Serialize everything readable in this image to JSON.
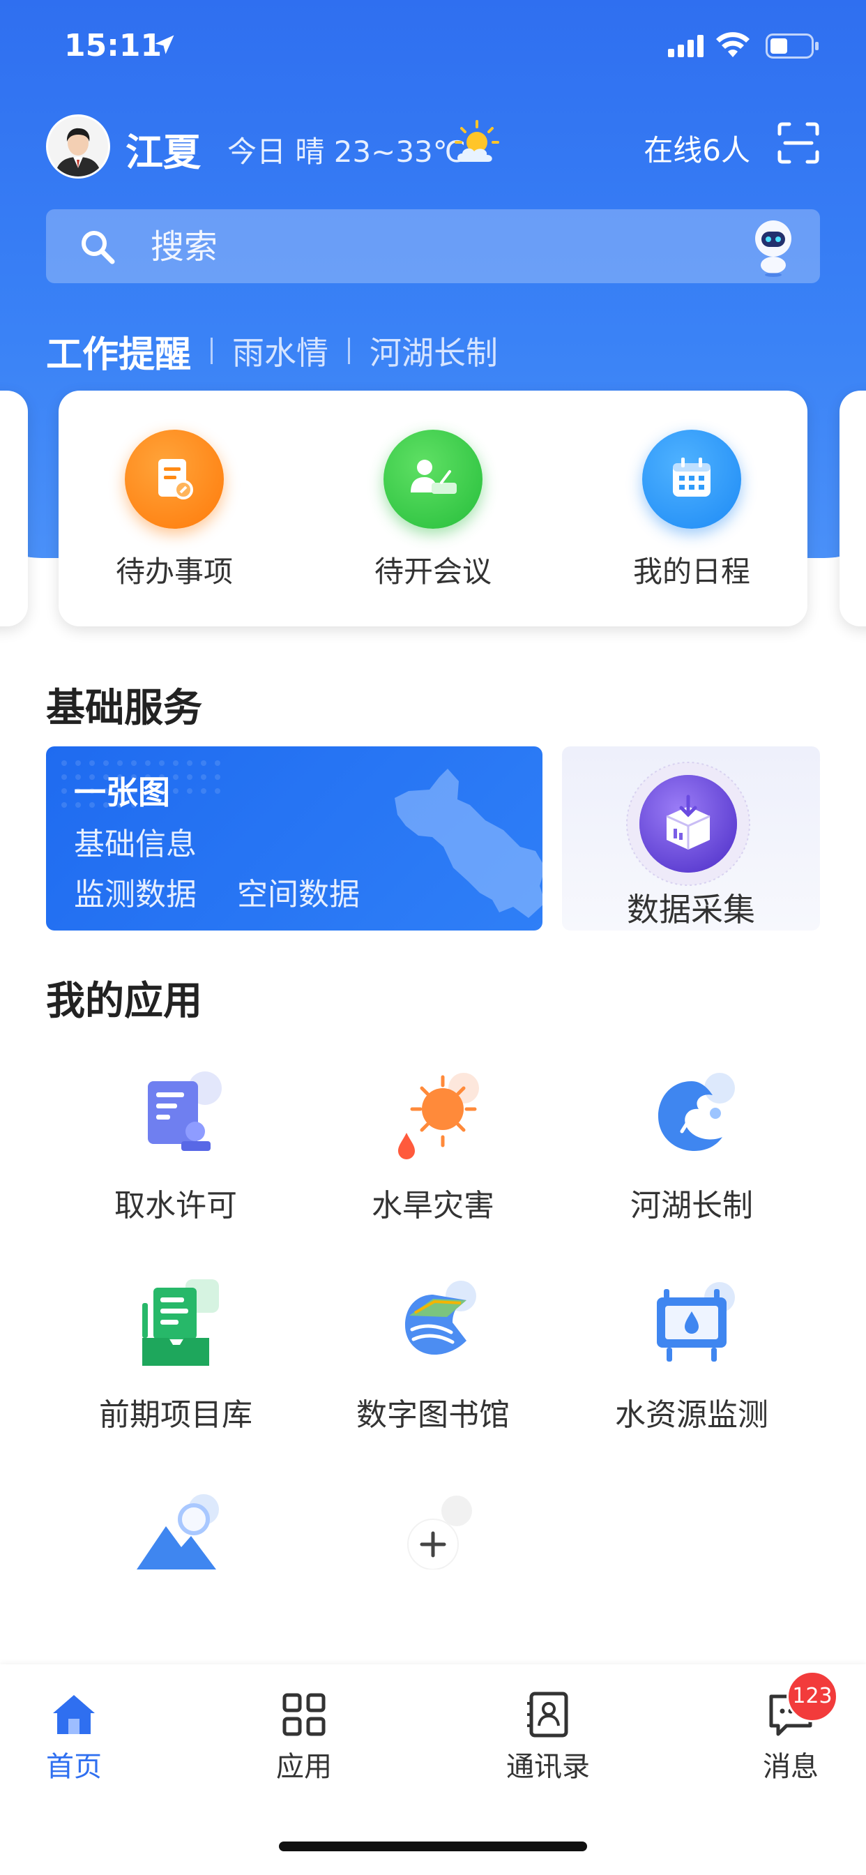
{
  "status_bar": {
    "time": "15:11"
  },
  "header": {
    "city": "江夏",
    "weather": "今日 晴 23~33℃",
    "online": "在线6人"
  },
  "search": {
    "placeholder": "搜索"
  },
  "tabs": [
    {
      "label": "工作提醒",
      "active": true
    },
    {
      "label": "雨水情",
      "active": false
    },
    {
      "label": "河湖长制",
      "active": false
    }
  ],
  "quick_actions": [
    {
      "label": "待办事项",
      "icon": "todo-icon",
      "color": "#ff8a14"
    },
    {
      "label": "待开会议",
      "icon": "meeting-icon",
      "color": "#3ccf4e"
    },
    {
      "label": "我的日程",
      "icon": "calendar-icon",
      "color": "#2f9bfa"
    }
  ],
  "basic_services": {
    "title": "基础服务",
    "map_card": {
      "title": "一张图",
      "line1": "基础信息",
      "line2a": "监测数据",
      "line2b": "空间数据"
    },
    "collect": {
      "label": "数据采集"
    }
  },
  "my_apps": {
    "title": "我的应用",
    "items": [
      {
        "label": "取水许可",
        "icon": "water-permit-icon"
      },
      {
        "label": "水旱灾害",
        "icon": "drought-flood-icon"
      },
      {
        "label": "河湖长制",
        "icon": "river-lake-icon"
      },
      {
        "label": "前期项目库",
        "icon": "project-library-icon"
      },
      {
        "label": "数字图书馆",
        "icon": "digital-library-icon"
      },
      {
        "label": "水资源监测",
        "icon": "water-monitor-icon"
      },
      {
        "label": "",
        "icon": "mountain-icon"
      },
      {
        "label": "",
        "icon": "add-icon"
      }
    ]
  },
  "tabbar": [
    {
      "label": "首页",
      "icon": "home-icon",
      "active": true
    },
    {
      "label": "应用",
      "icon": "apps-grid-icon",
      "active": false
    },
    {
      "label": "通讯录",
      "icon": "contacts-icon",
      "active": false
    },
    {
      "label": "消息",
      "icon": "message-icon",
      "active": false,
      "badge": "123"
    }
  ],
  "colors": {
    "primary": "#2f6ff0",
    "badge": "#f23b3b"
  }
}
